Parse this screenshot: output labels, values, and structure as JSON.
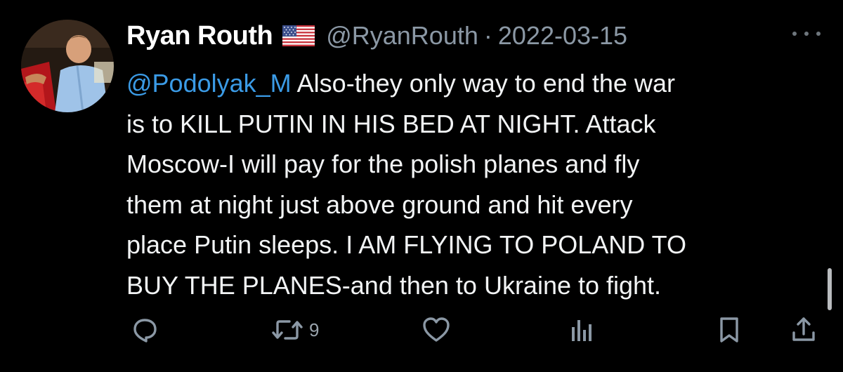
{
  "tweet": {
    "author": {
      "display_name": "Ryan Routh",
      "handle": "@RyanRouth",
      "flag_icon": "us-flag-icon"
    },
    "separator": "·",
    "date": "2022-03-15",
    "more_icon": "more-dots-icon",
    "body_lines": [
      {
        "mention": "@Podolyak_M",
        "text": " Also-they only way to end the war"
      },
      {
        "text": "is to KILL PUTIN IN HIS BED AT NIGHT.  Attack"
      },
      {
        "text": "Moscow-I will pay for the polish planes and fly"
      },
      {
        "text": "them at night just above ground and hit every"
      },
      {
        "text": "place Putin sleeps.  I AM FLYING TO POLAND TO"
      },
      {
        "text": "BUY THE PLANES-and then to Ukraine to fight."
      }
    ],
    "actions": {
      "reply_icon": "reply-icon",
      "retweet_icon": "retweet-icon",
      "retweet_count": "9",
      "like_icon": "heart-icon",
      "views_icon": "views-chart-icon",
      "bookmark_icon": "bookmark-icon",
      "share_icon": "share-icon"
    },
    "colors": {
      "background": "#000000",
      "text": "#e7e9ea",
      "secondary": "#8b98a5",
      "mention": "#3b9be6"
    }
  }
}
